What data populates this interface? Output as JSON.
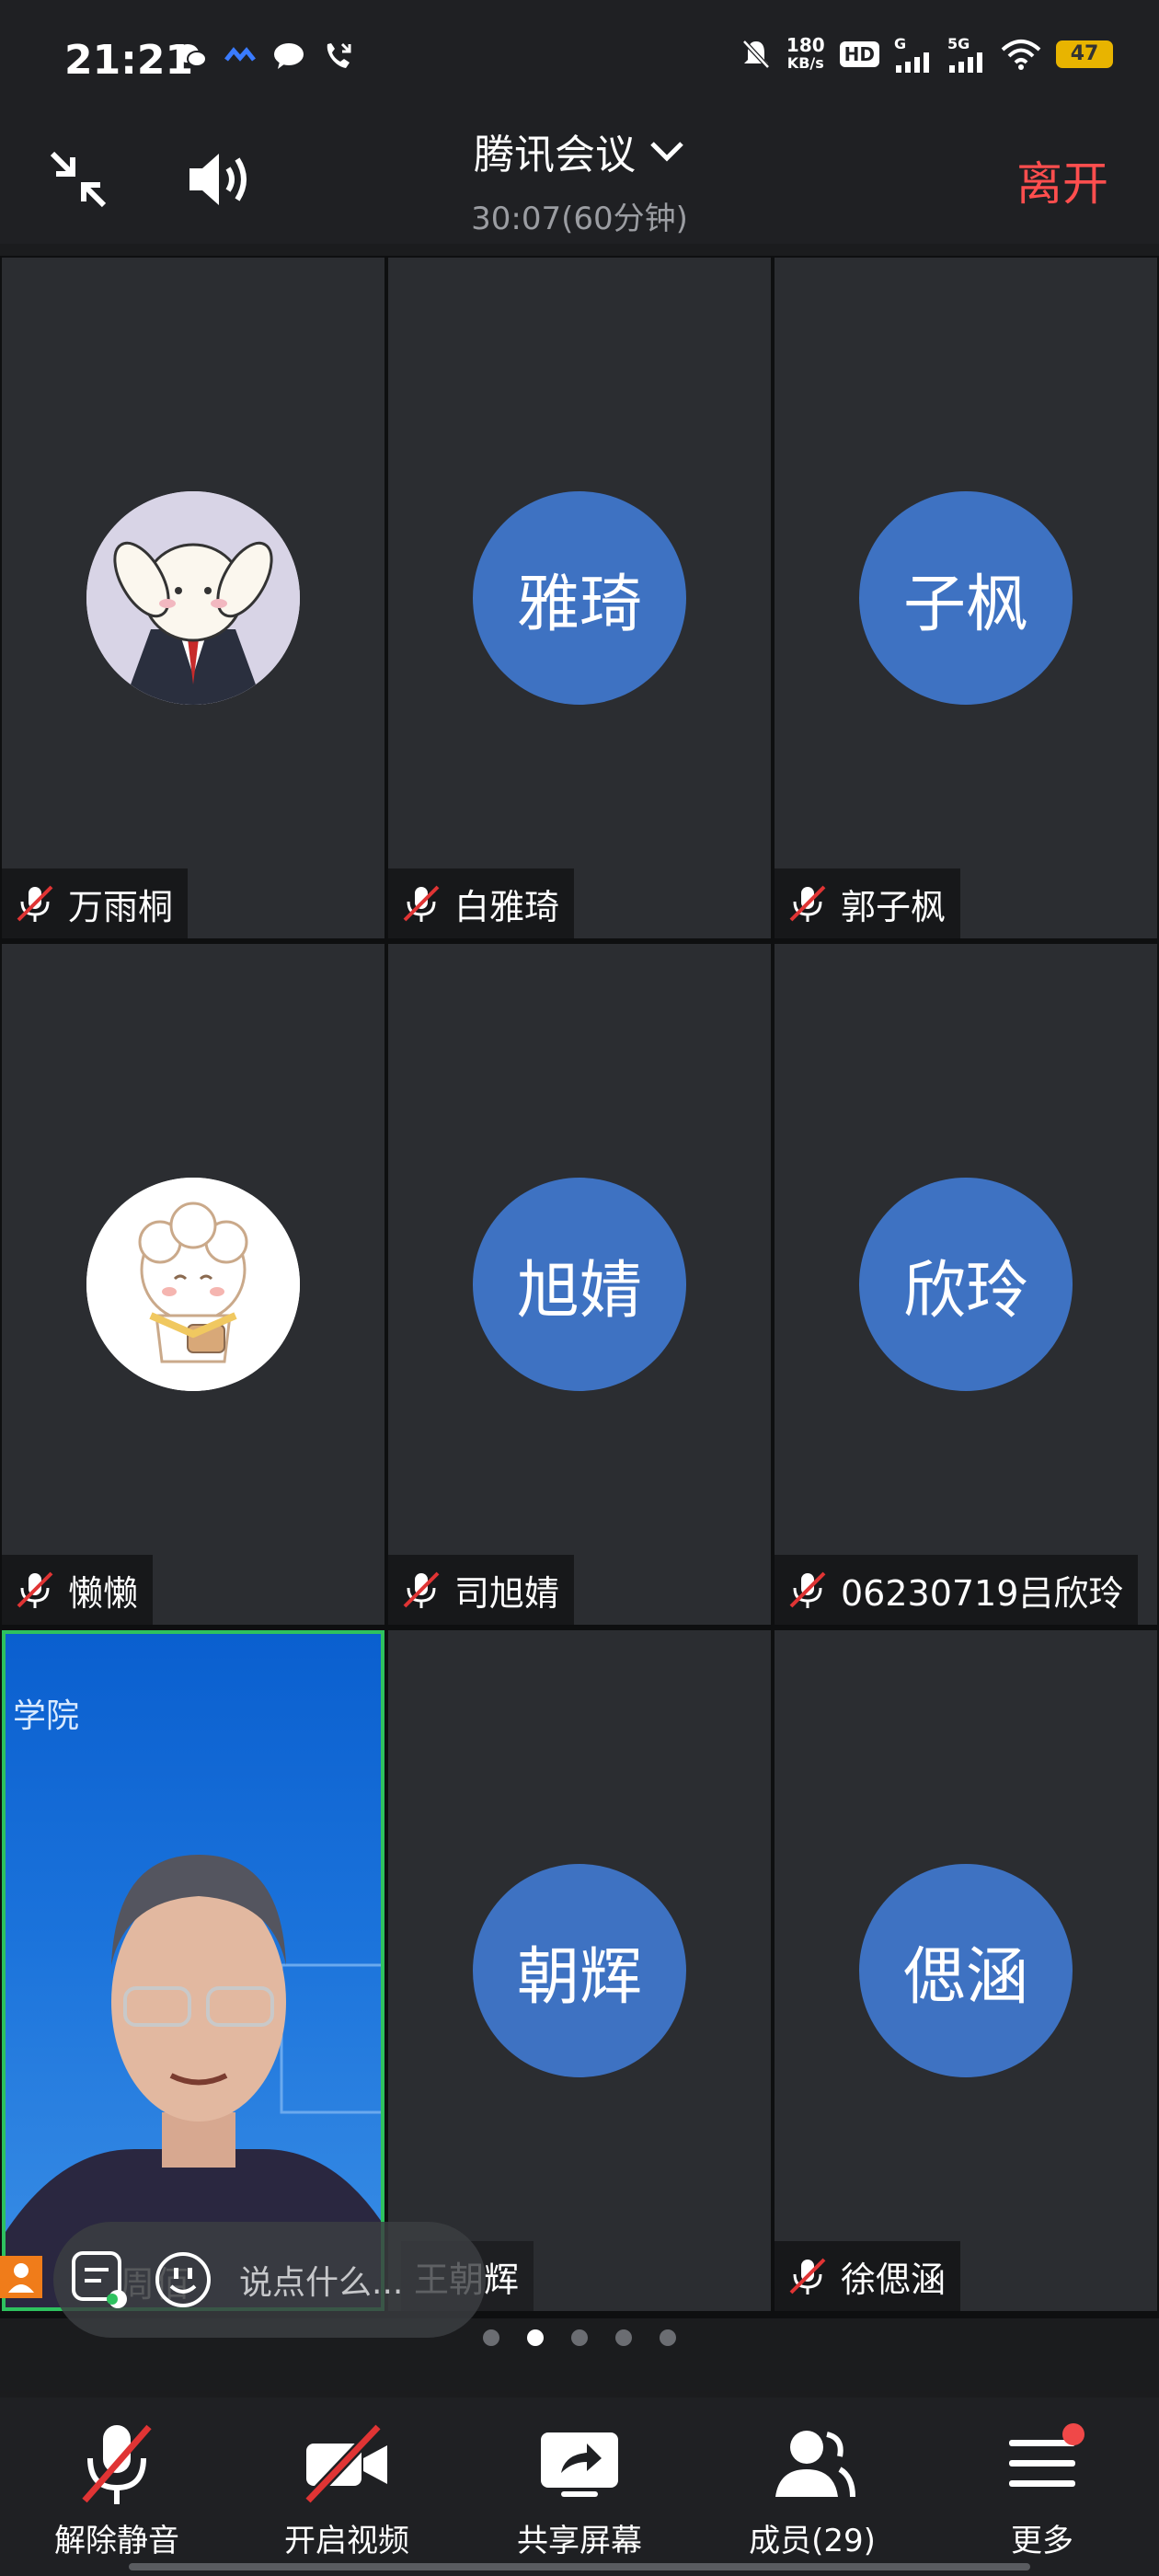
{
  "status_bar": {
    "time": "21:21",
    "net_speed_value": "180",
    "net_speed_unit": "KB/s",
    "battery": "47",
    "signal_labels": [
      "HD",
      "G",
      "5G"
    ]
  },
  "top_bar": {
    "title": "腾讯会议",
    "timer": "30:07(60分钟)",
    "leave_label": "离开"
  },
  "participants": [
    {
      "name": "万雨桐",
      "avatar_text": "",
      "avatar_type": "image-rabbit"
    },
    {
      "name": "白雅琦",
      "avatar_text": "雅琦",
      "avatar_type": "initials"
    },
    {
      "name": "郭子枫",
      "avatar_text": "子枫",
      "avatar_type": "initials"
    },
    {
      "name": "懒懒",
      "avatar_text": "",
      "avatar_type": "image-sheep"
    },
    {
      "name": "司旭婧",
      "avatar_text": "旭婧",
      "avatar_type": "initials"
    },
    {
      "name": "06230719吕欣玲",
      "avatar_text": "欣玲",
      "avatar_type": "initials"
    },
    {
      "name": "周佰",
      "avatar_text": "",
      "avatar_type": "video",
      "video_label": "学院"
    },
    {
      "name": "王朝辉",
      "avatar_text": "朝辉",
      "avatar_type": "initials"
    },
    {
      "name": "徐偲涵",
      "avatar_text": "偲涵",
      "avatar_type": "initials"
    }
  ],
  "chat": {
    "placeholder": "说点什么..."
  },
  "pagination": {
    "count": 5,
    "active_index": 1
  },
  "toolbar": {
    "unmute": "解除静音",
    "start_video": "开启视频",
    "share_screen": "共享屏幕",
    "members": "成员(29)",
    "more": "更多"
  },
  "colors": {
    "avatar_blue": "#3e72c2",
    "leave_red": "#ff4e4e",
    "active_speaker_green": "#2ec15f"
  }
}
